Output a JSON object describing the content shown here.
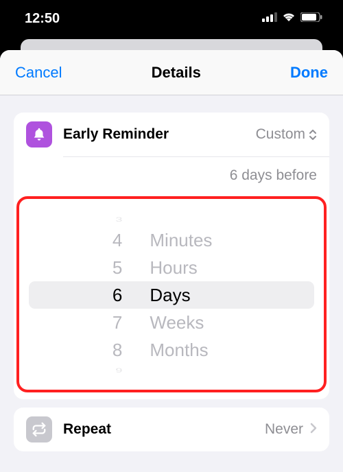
{
  "status": {
    "time": "12:50"
  },
  "nav": {
    "cancel": "Cancel",
    "title": "Details",
    "done": "Done"
  },
  "reminder": {
    "label": "Early Reminder",
    "value": "Custom",
    "summary": "6 days before"
  },
  "picker": {
    "numbers": {
      "n0": "3",
      "n1": "4",
      "n2": "5",
      "n3": "6",
      "n4": "7",
      "n5": "8",
      "n6": "9"
    },
    "units": {
      "u0": "Minutes",
      "u1": "Hours",
      "u2": "Days",
      "u3": "Weeks",
      "u4": "Months"
    }
  },
  "repeat": {
    "label": "Repeat",
    "value": "Never"
  }
}
